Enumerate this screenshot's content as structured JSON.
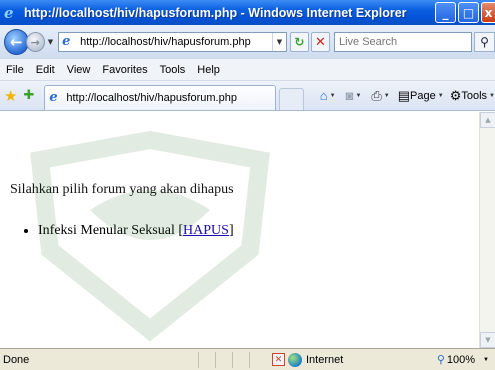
{
  "window": {
    "title": "http://localhost/hiv/hapusforum.php - Windows Internet Explorer"
  },
  "address_bar": {
    "url": "http://localhost/hiv/hapusforum.php"
  },
  "search": {
    "placeholder": "Live Search"
  },
  "menu": {
    "items": [
      "File",
      "Edit",
      "View",
      "Favorites",
      "Tools",
      "Help"
    ]
  },
  "tab": {
    "label": "http://localhost/hiv/hapusforum.php"
  },
  "command_bar": {
    "page_label": "Page",
    "tools_label": "Tools"
  },
  "content": {
    "prompt": "Silahkan pilih forum yang akan dihapus",
    "forums": [
      {
        "name": "Infeksi Menular Seksual",
        "action_label": "HAPUS"
      }
    ]
  },
  "status_bar": {
    "status": "Done",
    "zone": "Internet",
    "zoom": "100%"
  },
  "colors": {
    "titlebar": "#0553d8",
    "link": "#1a0dab"
  }
}
